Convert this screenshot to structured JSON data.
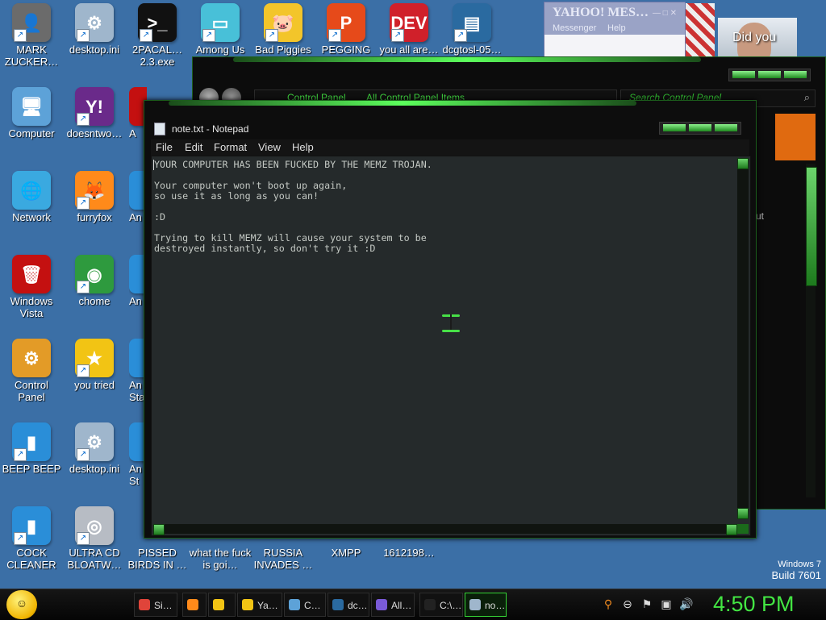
{
  "desktop": {
    "icons": [
      {
        "label": "MARK ZUCKER…",
        "name": "mark-zuckerberg-icon",
        "color": "#6b6b6b",
        "glyph": "👤"
      },
      {
        "label": "desktop.ini",
        "name": "desktop-ini-icon",
        "color": "#9fb6cc",
        "glyph": "⚙"
      },
      {
        "label": "2PACAL… 2.3.exe",
        "name": "2pacal-exe-icon",
        "color": "#111111",
        "glyph": ">_"
      },
      {
        "label": "Among Us",
        "name": "among-us-icon",
        "color": "#48c0d8",
        "glyph": "▭"
      },
      {
        "label": "Bad Piggies",
        "name": "bad-piggies-icon",
        "color": "#f3c52a",
        "glyph": "🐷"
      },
      {
        "label": "PEGGING",
        "name": "pegging-icon",
        "color": "#e64a1a",
        "glyph": "P"
      },
      {
        "label": "you all are…",
        "name": "you-all-are-icon",
        "color": "#d0202a",
        "glyph": "DEV"
      },
      {
        "label": "dcgtosl-05…",
        "name": "dcgtosl-icon",
        "color": "#2a6aa0",
        "glyph": "▤"
      },
      {
        "label": "Computer",
        "name": "computer-icon",
        "color": "#5da2d8",
        "glyph": "🖥"
      },
      {
        "label": "doesntwo…",
        "name": "doesntwork-icon",
        "color": "#6a2a8a",
        "glyph": "Y!"
      },
      {
        "label": "Network",
        "name": "network-icon",
        "color": "#3aa9e0",
        "glyph": "🌐"
      },
      {
        "label": "furryfox",
        "name": "furryfox-icon",
        "color": "#ff8a1a",
        "glyph": "🦊"
      },
      {
        "label": "Windows Vista",
        "name": "windows-vista-icon",
        "color": "#c41010",
        "glyph": "🗑"
      },
      {
        "label": "chome",
        "name": "chome-icon",
        "color": "#2e9a3e",
        "glyph": "◉"
      },
      {
        "label": "Control Panel",
        "name": "control-panel-icon",
        "color": "#e39b27",
        "glyph": "⚙"
      },
      {
        "label": "you tried",
        "name": "you-tried-icon",
        "color": "#f2c414",
        "glyph": "★"
      },
      {
        "label": "BEEP BEEP",
        "name": "beep-beep-icon",
        "color": "#2a8ed8",
        "glyph": "▮"
      },
      {
        "label": "desktop.ini",
        "name": "desktop-ini-icon-2",
        "color": "#9fb6cc",
        "glyph": "⚙"
      },
      {
        "label": "COCK CLEANER",
        "name": "cock-cleaner-icon",
        "color": "#2a8ed8",
        "glyph": "▮"
      },
      {
        "label": "ULTRA CD BLOATW…",
        "name": "ultra-cd-icon",
        "color": "#b7bcc4",
        "glyph": "◎"
      },
      {
        "label": "PISSED BIRDS IN …",
        "name": "pissed-birds-icon",
        "color": "#3b6fa6",
        "glyph": ""
      },
      {
        "label": "what the fuck is goi…",
        "name": "what-the-icon",
        "color": "#3b6fa6",
        "glyph": ""
      },
      {
        "label": "RUSSIA INVADES …",
        "name": "russia-invades-icon",
        "color": "#3b6fa6",
        "glyph": ""
      },
      {
        "label": "XMPP",
        "name": "xmpp-icon",
        "color": "#3b6fa6",
        "glyph": ""
      },
      {
        "label": "1612198…",
        "name": "file-1612198-icon",
        "color": "#3b6fa6",
        "glyph": ""
      },
      {
        "label": "A",
        "name": "partial-icon-1",
        "color": "#c41010",
        "glyph": ""
      },
      {
        "label": "An",
        "name": "partial-icon-2",
        "color": "#2a8ed8",
        "glyph": ""
      },
      {
        "label": "An",
        "name": "partial-icon-3",
        "color": "#2a8ed8",
        "glyph": ""
      },
      {
        "label": "An Sta",
        "name": "partial-icon-4",
        "color": "#2a8ed8",
        "glyph": ""
      },
      {
        "label": "An St",
        "name": "partial-icon-5",
        "color": "#2a8ed8",
        "glyph": ""
      }
    ],
    "watermark": {
      "line1": "Windows 7",
      "line2": "Build 7601"
    }
  },
  "yahoo_window": {
    "logo": "YAHOO! MES…",
    "messenger": "Messenger",
    "help": "Help",
    "photo_caption": "Did you"
  },
  "control_panel": {
    "address": "Control Panel",
    "address2": "All Control Panel Items",
    "search_placeholder": "Search Control Panel",
    "side_label": "ut"
  },
  "notepad": {
    "title": "note.txt - Notepad",
    "menu": {
      "file": "File",
      "edit": "Edit",
      "format": "Format",
      "view": "View",
      "help": "Help"
    },
    "lines": {
      "l1": "YOUR COMPUTER HAS BEEN FUCKED BY THE MEMZ TROJAN.",
      "l2": "Your computer won't boot up again,",
      "l3": "so use it as long as you can!",
      "l4": ":D",
      "l5": "Trying to kill MEMZ will cause your system to be",
      "l6": "destroyed instantly, so don't try it :D"
    }
  },
  "taskbar": {
    "items": [
      {
        "label": "Si…",
        "name": "taskbar-chrome",
        "color": "#e0443a"
      },
      {
        "label": "",
        "name": "taskbar-firefox",
        "color": "#ff8a1a"
      },
      {
        "label": "",
        "name": "taskbar-explorer",
        "color": "#f2c414"
      },
      {
        "label": "Ya…",
        "name": "taskbar-yahoo",
        "color": "#f2c414"
      },
      {
        "label": "C…",
        "name": "taskbar-control",
        "color": "#5da2d8"
      },
      {
        "label": "dc…",
        "name": "taskbar-dc",
        "color": "#2a6aa0"
      },
      {
        "label": "All…",
        "name": "taskbar-all",
        "color": "#7a5ad8"
      },
      {
        "label": "C:\\…",
        "name": "taskbar-cmd",
        "color": "#222222"
      },
      {
        "label": "no…",
        "name": "taskbar-notepad",
        "color": "#9fb6cc"
      }
    ],
    "clock": "4:50 PM"
  },
  "colors": {
    "accent": "#5cff5c",
    "background": "#3b6fa6"
  }
}
